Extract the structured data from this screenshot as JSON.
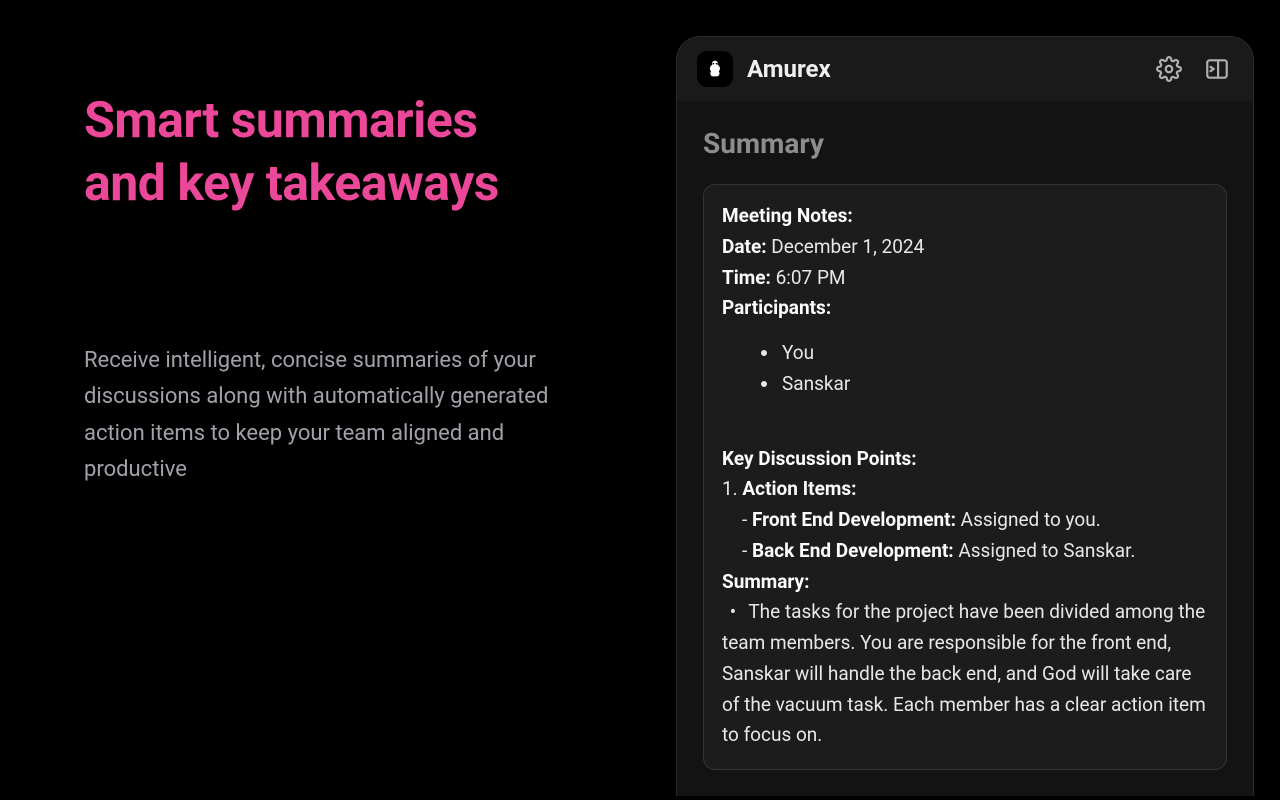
{
  "marketing": {
    "headline": "Smart summaries and key takeaways",
    "subcopy": "Receive intelligent, concise summaries of your discussions along with automatically generated action items to keep your team aligned and productive"
  },
  "panel": {
    "app_title": "Amurex",
    "section_title": "Summary",
    "notes": {
      "meeting_notes_label": "Meeting Notes:",
      "date_label": "Date:",
      "date_value": "December 1, 2024",
      "time_label": "Time:",
      "time_value": "6:07 PM",
      "participants_label": "Participants:",
      "participants": [
        "You",
        "Sanskar"
      ],
      "kdp_label": "Key Discussion Points:",
      "action_items_prefix": "1. ",
      "action_items_label": "Action Items:",
      "action_front_label": "Front End Development:",
      "action_front_value": "Assigned to you.",
      "action_back_label": "Back End Development:",
      "action_back_value": "Assigned to Sanskar.",
      "summary_label": "Summary:",
      "summary_text": "The tasks for the project have been divided among the team members. You are responsible for the front end, Sanskar will handle the back end, and God will take care of the vacuum task. Each member has a clear action item to focus on."
    }
  }
}
